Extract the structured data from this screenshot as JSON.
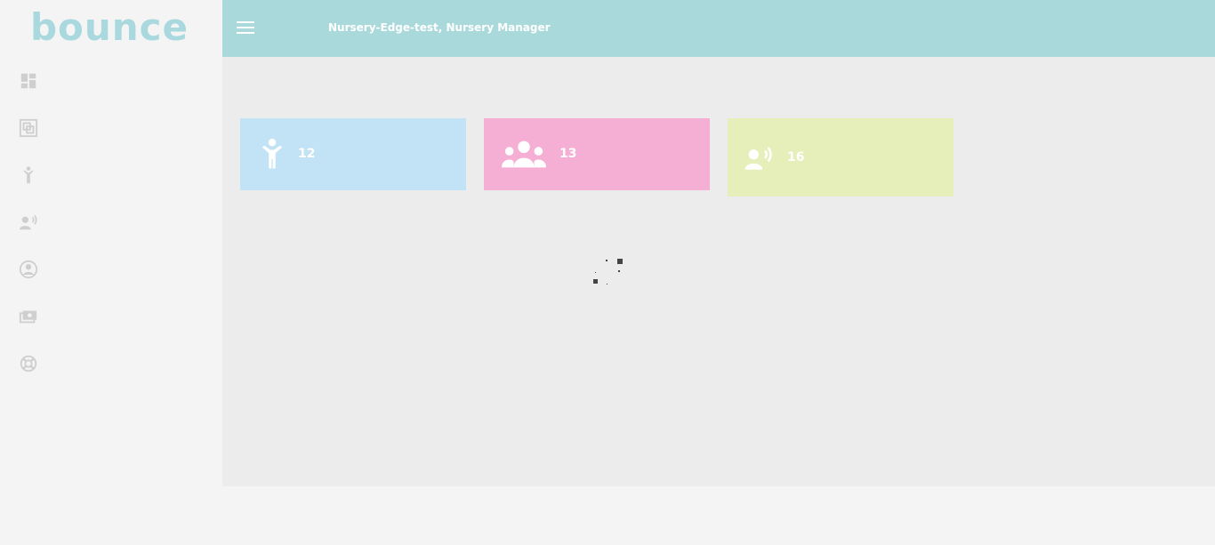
{
  "app": {
    "logo_text": "bounce"
  },
  "header": {
    "title": "Nursery-Edge-test, Nursery Manager"
  },
  "sidebar": {
    "items": [
      {
        "icon": "dashboard-icon"
      },
      {
        "icon": "gallery-icon"
      },
      {
        "icon": "child-icon"
      },
      {
        "icon": "parent-voice-icon"
      },
      {
        "icon": "profile-icon"
      },
      {
        "icon": "payments-icon"
      },
      {
        "icon": "support-icon"
      }
    ]
  },
  "stats": {
    "children_count": "12",
    "staff_count": "13",
    "parents_count": "16"
  },
  "colors": {
    "header_bg": "#aad9dc",
    "children_card": "#c2e2f5",
    "staff_card": "#f5aed4",
    "parents_card": "#e6eeb9",
    "logo": "#a9d9de"
  }
}
